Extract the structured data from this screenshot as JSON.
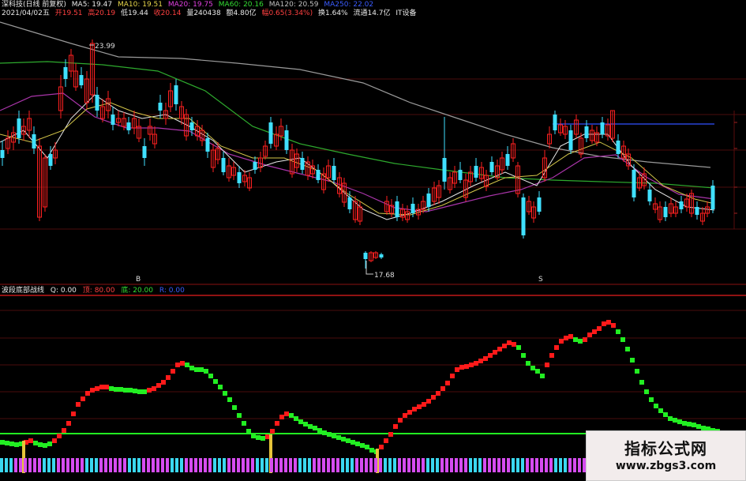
{
  "header": {
    "title": "深科技(日线 前复权)",
    "ma5": "MA5: 19.47",
    "ma10": "MA10: 19.51",
    "ma20": "MA20: 19.75",
    "ma60": "MA60: 20.16",
    "ma120": "MA120: 20.59",
    "ma250": "MA250: 22.02"
  },
  "quote": {
    "date": "2021/04/02五",
    "open": "开19.51",
    "high": "高20.19",
    "low": "低19.44",
    "close": "收20.14",
    "volume": "量240438",
    "amount": "额4.80亿",
    "change": "幅0.65(3.34%)",
    "turnover": "换1.64%",
    "float_cap": "流通14.7亿",
    "sector": "IT设备"
  },
  "annotations": {
    "high_price": "23.99",
    "low_price": "17.68",
    "marker_left": "B",
    "marker_right": "S"
  },
  "indicator": {
    "name": "波段底部战线",
    "q_value": "Q: 0.00",
    "top": "顶: 80.00",
    "bottom": "底: 20.00",
    "extra": "R: 0.00"
  },
  "logo": {
    "title": "指标公式网",
    "url": "www.zbgs3.com"
  },
  "colors": {
    "up": "#ff2020",
    "down": "#40e0ff",
    "ind_up": "#ff1a1a",
    "ind_down": "#22ee22",
    "buy": "#e6c33a",
    "bar_a": "#d64cf0",
    "bar_b": "#3ad8f0"
  },
  "chart_data": [
    {
      "type": "candlestick",
      "title": "深科技(日线 前复权)",
      "series": [
        {
          "name": "MA5",
          "value": 19.47
        },
        {
          "name": "MA10",
          "value": 19.51
        },
        {
          "name": "MA20",
          "value": 19.75
        },
        {
          "name": "MA60",
          "value": 20.16
        },
        {
          "name": "MA120",
          "value": 20.59
        },
        {
          "name": "MA250",
          "value": 22.02
        }
      ],
      "annotations": [
        "23.99",
        "17.68"
      ]
    },
    {
      "type": "line",
      "title": "波段底部战线",
      "series": [
        {
          "name": "Q",
          "value": 0.0
        },
        {
          "name": "顶",
          "value": 80.0
        },
        {
          "name": "底",
          "value": 20.0
        }
      ]
    }
  ]
}
